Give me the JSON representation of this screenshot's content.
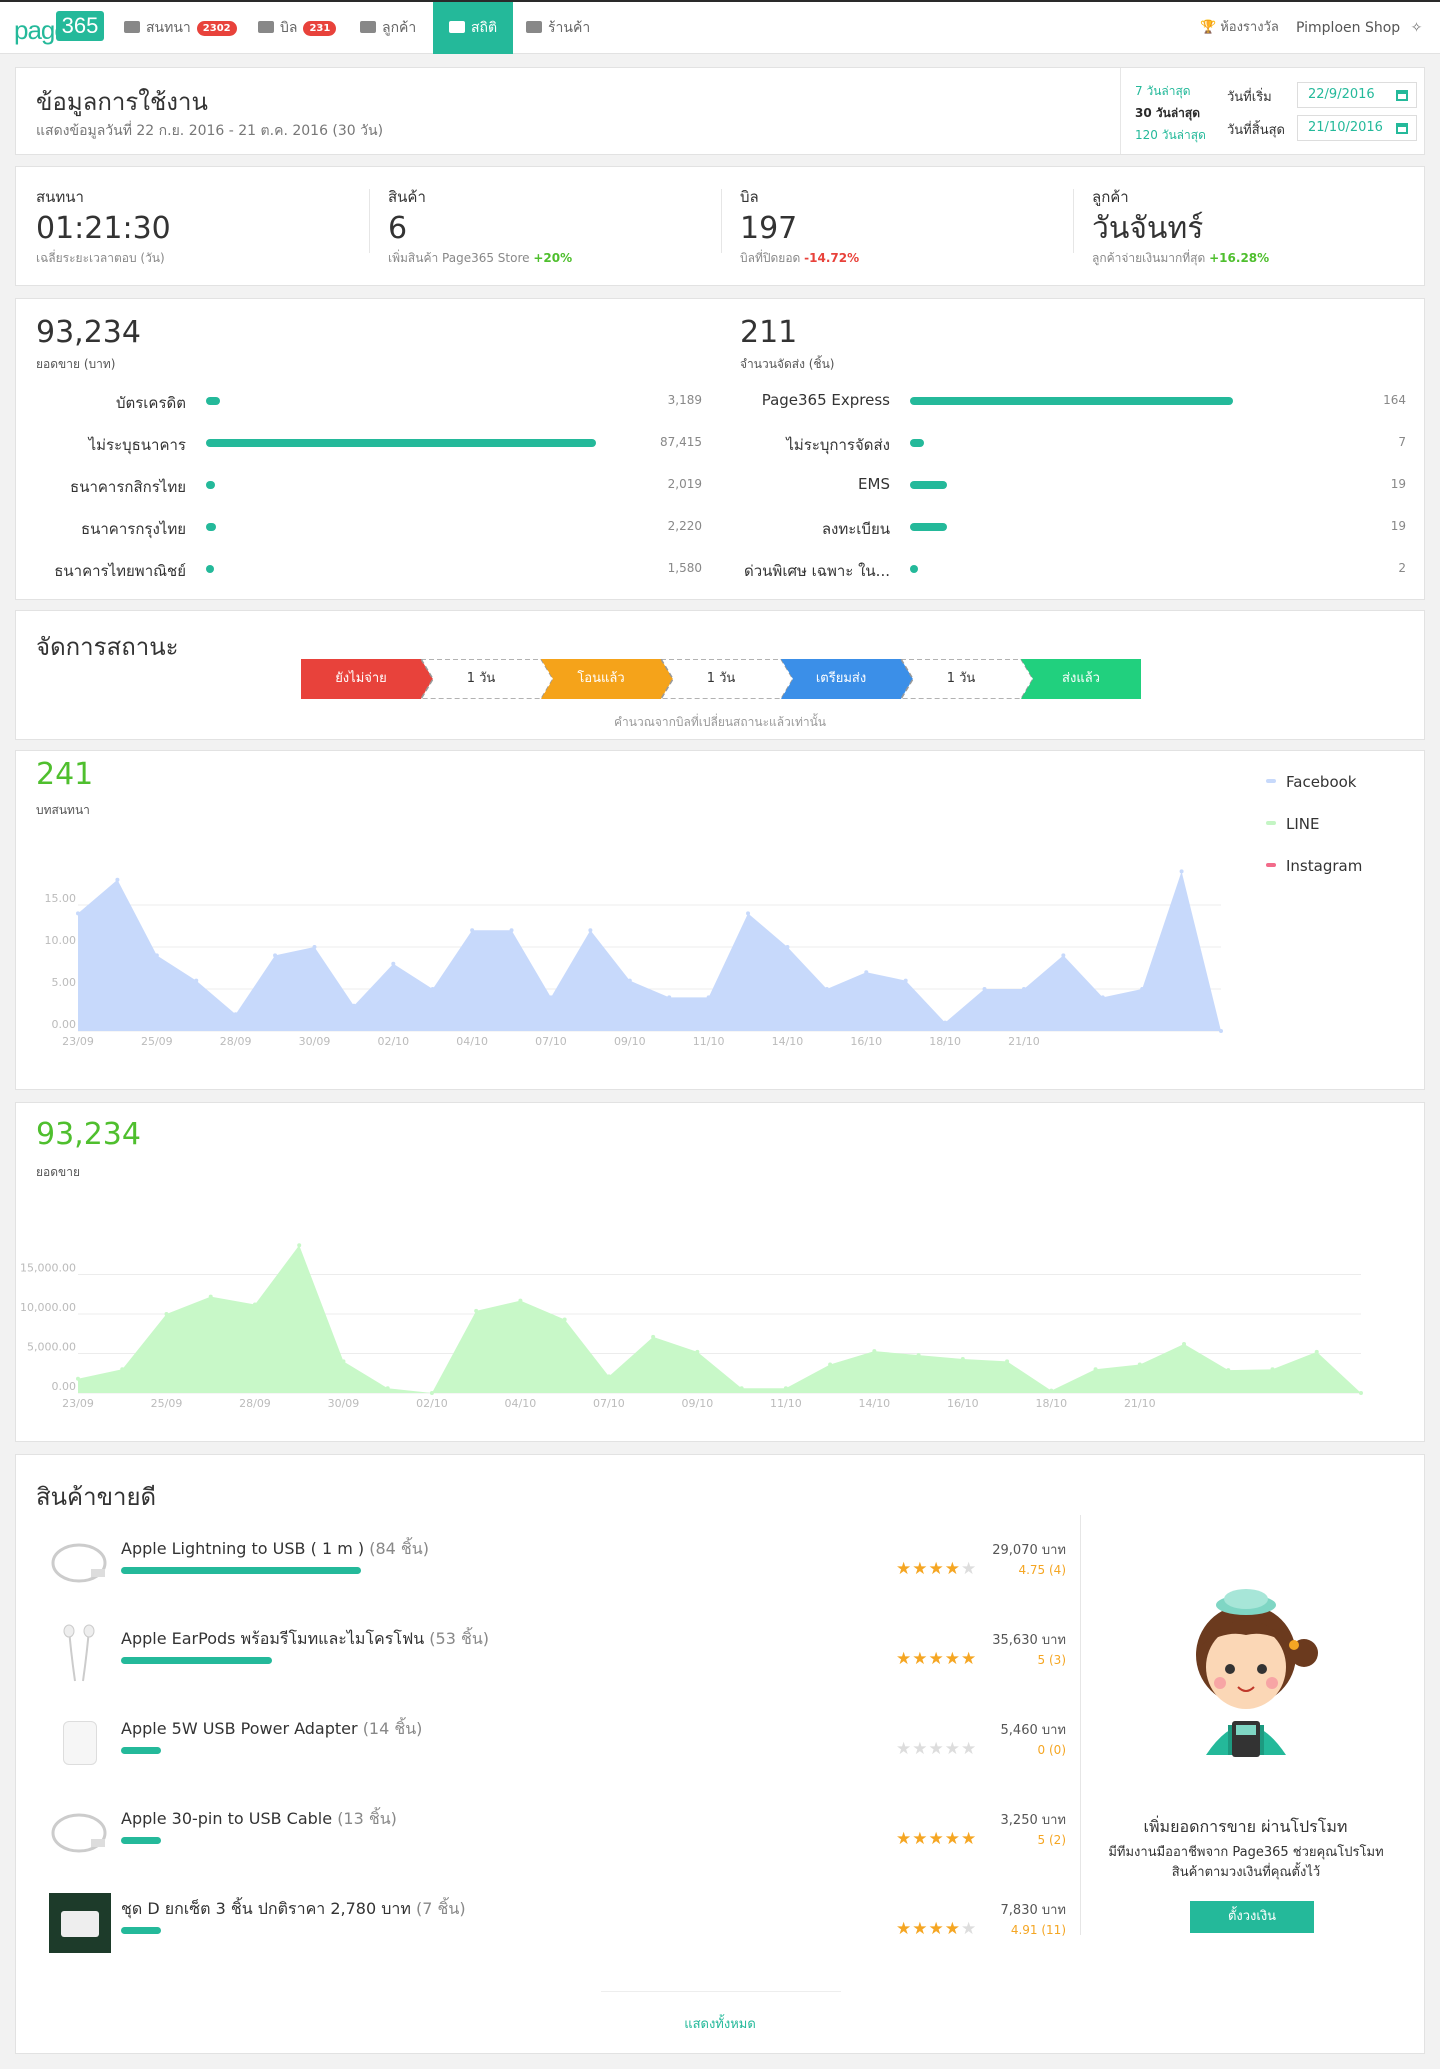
{
  "nav": {
    "logo_text": "page",
    "logo_box": "365",
    "items": [
      {
        "label": "สนทนา",
        "badge": "2302",
        "icon": "chat-icon"
      },
      {
        "label": "บิล",
        "badge": "231",
        "icon": "bill-icon"
      },
      {
        "label": "ลูกค้า",
        "badge": "",
        "icon": "users-icon"
      },
      {
        "label": "สถิติ",
        "badge": "",
        "icon": "chart-icon",
        "active": true
      },
      {
        "label": "ร้านค้า",
        "badge": "",
        "icon": "store-icon"
      }
    ],
    "awards": "ห้องรางวัล",
    "shop": "Pimploen Shop"
  },
  "header": {
    "title": "ข้อมูลการใช้งาน",
    "subtitle": "แสดงข้อมูลวันที่ 22 ก.ย. 2016 - 21 ต.ค. 2016 (30 วัน)",
    "quick": [
      "7 วันล่าสุด",
      "30 วันล่าสุด",
      "120 วันล่าสุด"
    ],
    "start_label": "วันที่เริ่ม",
    "start_value": "22/9/2016",
    "end_label": "วันที่สิ้นสุด",
    "end_value": "21/10/2016"
  },
  "kpis": [
    {
      "label": "สนทนา",
      "value": "01:21:30",
      "sub": "เฉลี่ยระยะเวลาตอบ (วัน)",
      "delta": ""
    },
    {
      "label": "สินค้า",
      "value": "6",
      "sub": "เพิ่มสินค้า Page365 Store",
      "delta": "+20%"
    },
    {
      "label": "บิล",
      "value": "197",
      "sub": "บิลที่ปิดยอด",
      "delta": "-14.72%"
    },
    {
      "label": "ลูกค้า",
      "value": "วันจันทร์",
      "sub": "ลูกค้าจ่ายเงินมากที่สุด",
      "delta": "+16.28%"
    }
  ],
  "payments": {
    "value": "93,234",
    "label": "ยอดขาย (บาท)",
    "rows": [
      {
        "label": "บัตรเครดิต",
        "amount": 3189,
        "display": "3,189"
      },
      {
        "label": "ไม่ระบุธนาคาร",
        "amount": 87415,
        "display": "87,415"
      },
      {
        "label": "ธนาคารกสิกรไทย",
        "amount": 2019,
        "display": "2,019"
      },
      {
        "label": "ธนาคารกรุงไทย",
        "amount": 2220,
        "display": "2,220"
      },
      {
        "label": "ธนาคารไทยพาณิชย์",
        "amount": 1580,
        "display": "1,580"
      }
    ]
  },
  "shipping": {
    "value": "211",
    "label": "จำนวนจัดส่ง (ชิ้น)",
    "rows": [
      {
        "label": "Page365 Express",
        "amount": 164,
        "display": "164"
      },
      {
        "label": "ไม่ระบุการจัดส่ง",
        "amount": 7,
        "display": "7"
      },
      {
        "label": "EMS",
        "amount": 19,
        "display": "19"
      },
      {
        "label": "ลงทะเบียน",
        "amount": 19,
        "display": "19"
      },
      {
        "label": "ด่วนพิเศษ เฉพาะ ใน...",
        "amount": 2,
        "display": "2"
      }
    ]
  },
  "status_flow": {
    "title": "จัดการสถานะ",
    "steps": [
      {
        "label": "ยังไม่จ่าย",
        "color": "#e8423b",
        "kind": "status"
      },
      {
        "label": "1 วัน",
        "kind": "duration"
      },
      {
        "label": "โอนแล้ว",
        "color": "#f5a31a",
        "kind": "status"
      },
      {
        "label": "1 วัน",
        "kind": "duration"
      },
      {
        "label": "เตรียมส่ง",
        "color": "#3b8fe8",
        "kind": "status"
      },
      {
        "label": "1 วัน",
        "kind": "duration"
      },
      {
        "label": "ส่งแล้ว",
        "color": "#21d07e",
        "kind": "status"
      }
    ],
    "note": "คำนวณจากบิลที่เปลี่ยนสถานะแล้วเท่านั้น"
  },
  "chart_data": [
    {
      "type": "area",
      "headline": "241",
      "headline_label": "บทสนทนา",
      "x": [
        "23/09",
        "24/09",
        "25/09",
        "26/09",
        "27/09",
        "28/09",
        "29/09",
        "30/09",
        "01/10",
        "02/10",
        "03/10",
        "04/10",
        "05/10",
        "06/10",
        "07/10",
        "08/10",
        "09/10",
        "10/10",
        "11/10",
        "12/10",
        "13/10",
        "14/10",
        "15/10",
        "16/10",
        "17/10",
        "18/10",
        "19/10",
        "20/10",
        "21/10",
        "22/10"
      ],
      "x_ticks": [
        "23/09",
        "25/09",
        "28/09",
        "30/09",
        "02/10",
        "04/10",
        "07/10",
        "09/10",
        "11/10",
        "14/10",
        "16/10",
        "18/10",
        "21/10"
      ],
      "x_tick_index": [
        0,
        2,
        4,
        6,
        8,
        10,
        12,
        14,
        16,
        18,
        20,
        22,
        24
      ],
      "y_ticks": [
        "0.00",
        "5.00",
        "10.00",
        "15.00"
      ],
      "ylim": [
        0,
        20
      ],
      "series": [
        {
          "name": "Facebook",
          "color": "#c7d9fb",
          "values": [
            14,
            18,
            9,
            6,
            2,
            9,
            10,
            3,
            8,
            5,
            12,
            12,
            4,
            12,
            6,
            4,
            4,
            14,
            10,
            5,
            7,
            6,
            1,
            5,
            5,
            9,
            4,
            5,
            19,
            0
          ]
        },
        {
          "name": "LINE",
          "color": "#c4f5c4",
          "values": []
        },
        {
          "name": "Instagram",
          "color": "#f26b8a",
          "values": []
        }
      ]
    },
    {
      "type": "area",
      "headline": "93,234",
      "headline_label": "ยอดขาย",
      "x": [
        "23/09",
        "24/09",
        "25/09",
        "26/09",
        "27/09",
        "28/09",
        "29/09",
        "30/09",
        "01/10",
        "02/10",
        "03/10",
        "04/10",
        "05/10",
        "06/10",
        "07/10",
        "08/10",
        "09/10",
        "10/10",
        "11/10",
        "12/10",
        "13/10",
        "14/10",
        "15/10",
        "16/10",
        "17/10",
        "18/10",
        "19/10",
        "20/10",
        "21/10",
        "22/10"
      ],
      "x_ticks": [
        "23/09",
        "25/09",
        "28/09",
        "30/09",
        "02/10",
        "04/10",
        "07/10",
        "09/10",
        "11/10",
        "14/10",
        "16/10",
        "18/10",
        "21/10"
      ],
      "x_tick_index": [
        0,
        2,
        4,
        6,
        8,
        10,
        12,
        14,
        16,
        18,
        20,
        22,
        24
      ],
      "y_ticks": [
        "0.00",
        "5,000.00",
        "10,000.00",
        "15,000.00"
      ],
      "ylim": [
        0,
        20000
      ],
      "series": [
        {
          "name": "",
          "color": "#c8f8c8",
          "values": [
            1800,
            3000,
            10000,
            12200,
            11200,
            18700,
            4000,
            600,
            0,
            10400,
            11700,
            9300,
            2100,
            7100,
            5200,
            600,
            600,
            3600,
            5300,
            4800,
            4300,
            4000,
            300,
            3000,
            3600,
            6200,
            2900,
            3000,
            5200,
            0
          ]
        }
      ]
    }
  ],
  "bestsellers": {
    "title": "สินค้าขายดี",
    "max_qty": 84,
    "items": [
      {
        "name": "Apple Lightning to USB ( 1 m )",
        "qty": 84,
        "qty_label": "(84 ชิ้น)",
        "price": "29,070 บาท",
        "stars": 4,
        "rating": "4.75 (4)",
        "img": "cable-icon"
      },
      {
        "name": "Apple EarPods พร้อมรีโมทและไมโครโฟน",
        "qty": 53,
        "qty_label": "(53 ชิ้น)",
        "price": "35,630 บาท",
        "stars": 5,
        "rating": "5 (3)",
        "img": "earpods-icon"
      },
      {
        "name": "Apple 5W USB Power Adapter",
        "qty": 14,
        "qty_label": "(14 ชิ้น)",
        "price": "5,460 บาท",
        "stars": 0,
        "rating": "0 (0)",
        "img": "adapter-icon"
      },
      {
        "name": "Apple 30-pin to USB Cable",
        "qty": 13,
        "qty_label": "(13 ชิ้น)",
        "price": "3,250 บาท",
        "stars": 5,
        "rating": "5 (2)",
        "img": "cable-icon"
      },
      {
        "name": "ชุด D ยกเซ็ต 3 ชิ้น ปกติราคา 2,780 บาท",
        "qty": 7,
        "qty_label": "(7 ชิ้น)",
        "price": "7,830 บาท",
        "stars": 4,
        "rating": "4.91 (11)",
        "img": "bundle-icon"
      }
    ],
    "promo_title": "เพิ่มยอดการขาย ผ่านโปรโมท",
    "promo_desc": "มีทีมงานมืออาชีพจาก Page365 ช่วยคุณโปรโมทสินค้าตามวงเงินที่คุณตั้งไว้",
    "promo_button": "ตั้งวงเงิน",
    "show_all": "แสดงทั้งหมด"
  }
}
